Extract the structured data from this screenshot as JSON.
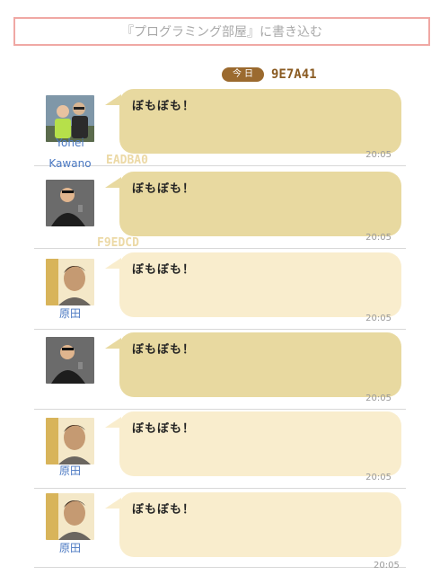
{
  "post_box": {
    "placeholder": "『プログラミング部屋』に書き込む"
  },
  "date_header": {
    "label": "今日",
    "hex": "9E7A41"
  },
  "floating_hex": [
    "EADBA0",
    "F9EDCD"
  ],
  "colors": {
    "bubble_dark": "#E8D9A0",
    "bubble_light": "#F9EDCD",
    "date_pill": "#9B6A2F",
    "username": "#4A78C2"
  },
  "messages": [
    {
      "user": "Yohei Kawano",
      "user_line1": "Yohei",
      "user_line2": "Kawano",
      "avatar": "two-people-avatar",
      "text": "ぼもぼも！",
      "time": "20:05",
      "bubble_color": "#E8D9A0"
    },
    {
      "user": "",
      "avatar": "speaker-avatar",
      "text": "ぼもぼも！",
      "time": "20:05",
      "bubble_color": "#E8D9A0"
    },
    {
      "user": "原田",
      "avatar": "profile-avatar",
      "text": "ぼもぼも！",
      "time": "20:05",
      "bubble_color": "#F9EDCD"
    },
    {
      "user": "",
      "avatar": "speaker-avatar",
      "text": "ぼもぼも！",
      "time": "20:05",
      "bubble_color": "#E8D9A0"
    },
    {
      "user": "原田",
      "avatar": "profile-avatar",
      "text": "ぼもぼも！",
      "time": "20:05",
      "bubble_color": "#F9EDCD"
    },
    {
      "user": "原田",
      "avatar": "profile-avatar",
      "text": "ぼもぼも！",
      "time": "20:05",
      "bubble_color": "#F9EDCD"
    }
  ],
  "last_time": "20:05"
}
